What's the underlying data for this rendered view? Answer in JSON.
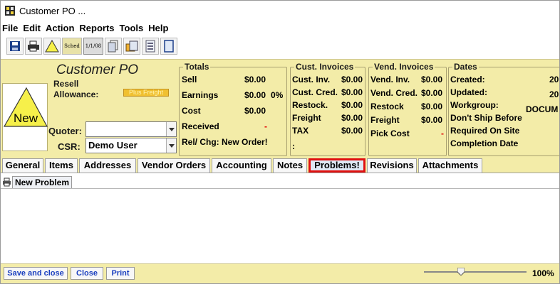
{
  "window": {
    "title": "Customer PO ..."
  },
  "menu": [
    "File",
    "Edit",
    "Action",
    "Reports",
    "Tools",
    "Help"
  ],
  "toolbar": {
    "icons": [
      "save-icon",
      "print-icon",
      "warning-icon",
      "schedule-icon",
      "date-icon",
      "documents-icon",
      "folders-icon",
      "list-icon",
      "page-icon"
    ],
    "sched_label": "Sched",
    "date_label": "1/1/08"
  },
  "header": {
    "title": "Customer PO",
    "status_badge": "New",
    "resell_label": "Resell",
    "allowance_label": "Allowance:",
    "allowance_value": "Plus Freight",
    "quoter_label": "Quoter:",
    "quoter_value": "",
    "csr_label": "CSR:",
    "csr_value": "Demo User",
    "colors": {
      "panel_bg": "#f3eca8",
      "badge_yellow": "#f6f04a",
      "plus_freight": "#f0c030"
    }
  },
  "totals": {
    "title": "Totals",
    "sell_label": "Sell",
    "sell_value": "$0.00",
    "earnings_label": "Earnings",
    "earnings_value": "$0.00",
    "earnings_pct": "0%",
    "cost_label": "Cost",
    "cost_value": "$0.00",
    "received_label": "Received",
    "received_value": "-",
    "relchg_label": "Rel/ Chg: New Order!"
  },
  "cust_invoices": {
    "title": "Cust. Invoices",
    "rows": [
      {
        "label": "Cust. Inv.",
        "value": "$0.00"
      },
      {
        "label": "Cust. Cred.",
        "value": "$0.00"
      },
      {
        "label": "Restock.",
        "value": "$0.00"
      },
      {
        "label": "Freight",
        "value": "$0.00"
      },
      {
        "label": "TAX",
        "value": "$0.00"
      }
    ],
    "footer": ":"
  },
  "vend_invoices": {
    "title": "Vend. Invoices",
    "rows": [
      {
        "label": "Vend. Inv.",
        "value": "$0.00"
      },
      {
        "label": "Vend. Cred.",
        "value": "$0.00"
      },
      {
        "label": "Restock",
        "value": "$0.00"
      },
      {
        "label": "Freight",
        "value": "$0.00"
      }
    ],
    "pick_cost_label": "Pick Cost",
    "pick_cost_value": "-"
  },
  "dates": {
    "title": "Dates",
    "created_label": "Created:",
    "created_value": "20",
    "updated_label": "Updated:",
    "updated_value": "20",
    "workgroup_label": "Workgroup:",
    "workgroup_value": "DOCUM",
    "dont_ship_label": "Don't Ship Before",
    "required_label": "Required On Site",
    "completion_label": "Completion Date"
  },
  "tabs": [
    "General",
    "Items",
    "Addresses",
    "Vendor Orders",
    "Accounting",
    "Notes",
    "Problems!",
    "Revisions",
    "Attachments"
  ],
  "active_tab": "Problems!",
  "problems": {
    "new_button": "New Problem"
  },
  "bottom": {
    "save_close": "Save and close",
    "close": "Close",
    "print": "Print",
    "zoom_label": "100%",
    "zoom_level": 0.35
  }
}
